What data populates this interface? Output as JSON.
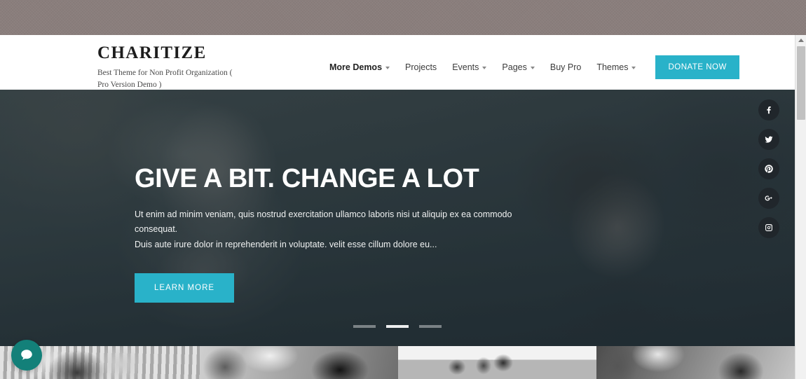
{
  "topbar": {
    "label": "desktop-background"
  },
  "header": {
    "brand_title": "CHARITIZE",
    "brand_tagline": "Best Theme for Non Profit Organization ( Pro Version Demo )",
    "nav": [
      {
        "label": "More Demos",
        "has_dropdown": true,
        "active": true
      },
      {
        "label": "Projects",
        "has_dropdown": false,
        "active": false
      },
      {
        "label": "Events",
        "has_dropdown": true,
        "active": false
      },
      {
        "label": "Pages",
        "has_dropdown": true,
        "active": false
      },
      {
        "label": "Buy Pro",
        "has_dropdown": false,
        "active": false
      },
      {
        "label": "Themes",
        "has_dropdown": true,
        "active": false
      }
    ],
    "donate_label": "DONATE NOW",
    "accent_color": "#29b2c9"
  },
  "hero": {
    "title": "GIVE A BIT. CHANGE A LOT",
    "subtitle_line1": "Ut enim ad minim veniam, quis nostrud exercitation ullamco laboris nisi ut aliquip ex ea commodo consequat.",
    "subtitle_line2": "Duis aute irure dolor in reprehenderit in voluptate. velit esse cillum dolore eu...",
    "cta_label": "LEARN MORE",
    "slides": [
      {
        "index": 1,
        "active": false
      },
      {
        "index": 2,
        "active": true
      },
      {
        "index": 3,
        "active": false
      }
    ]
  },
  "social": [
    {
      "name": "facebook-icon",
      "label": "Facebook"
    },
    {
      "name": "twitter-icon",
      "label": "Twitter"
    },
    {
      "name": "pinterest-icon",
      "label": "Pinterest"
    },
    {
      "name": "google-plus-icon",
      "label": "Google Plus"
    },
    {
      "name": "instagram-icon",
      "label": "Instagram"
    }
  ],
  "gallery": {
    "tiles": [
      {
        "alt": "gallery-photo-1"
      },
      {
        "alt": "gallery-photo-2"
      },
      {
        "alt": "gallery-photo-3"
      },
      {
        "alt": "gallery-photo-4"
      }
    ]
  },
  "chat": {
    "label": "chat-bubble",
    "color": "#138079"
  },
  "scrollbar": {
    "position": "right"
  }
}
